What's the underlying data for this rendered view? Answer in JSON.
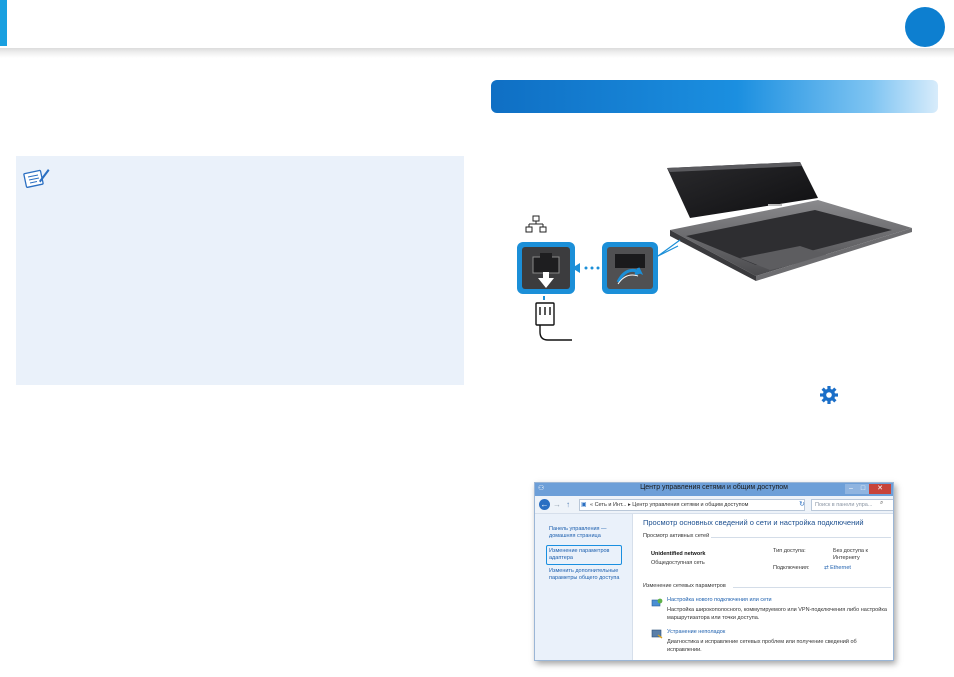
{
  "window": {
    "title": "Центр управления сетями и общим доступом",
    "controls": {
      "minimize": "–",
      "maximize": "□",
      "close": "✕"
    }
  },
  "address_bar": {
    "back": "←",
    "forward": "→",
    "up": "↑",
    "path": "« Сеть и Инт... ▸ Центр управления сетями и общим доступом",
    "refresh": "↻",
    "search_placeholder": "Поиск в панели упра...",
    "search_icon": "⌕"
  },
  "sidebar": {
    "items": [
      {
        "label": "Панель управления — домашняя страница"
      },
      {
        "label": "Изменение параметров адаптера"
      },
      {
        "label": "Изменить дополнительные параметры общего доступа"
      }
    ]
  },
  "main": {
    "title": "Просмотр основных сведений о сети и настройка подключений",
    "active_networks_label": "Просмотр активных сетей",
    "network_name": "Unidentified network",
    "network_type": "Общедоступная сеть",
    "access_type_label": "Тип доступа:",
    "access_type_value": "Без доступа к Интернету",
    "connections_label": "Подключения:",
    "connections_value": "Ethernet",
    "change_settings_label": "Изменение сетевых параметров",
    "tasks": [
      {
        "link": "Настройка нового подключения или сети",
        "desc": "Настройка широкополосного, коммутируемого или VPN-подключения либо настройка маршрутизатора или точки доступа."
      },
      {
        "link": "Устранение неполадок",
        "desc": "Диагностика и исправление сетевых проблем или получение сведений об исправлении."
      }
    ]
  },
  "icons": {
    "note": "note-pencil-icon",
    "network": "network-icon",
    "gear": "gear-icon",
    "lan_port": "lan-port-icon",
    "cable": "ethernet-cable-icon"
  },
  "colors": {
    "accent": "#1aa0e0",
    "section_bar": "#0f6fc4",
    "note_bg": "#eaf1fa",
    "highlight": "#1a8fe0"
  }
}
